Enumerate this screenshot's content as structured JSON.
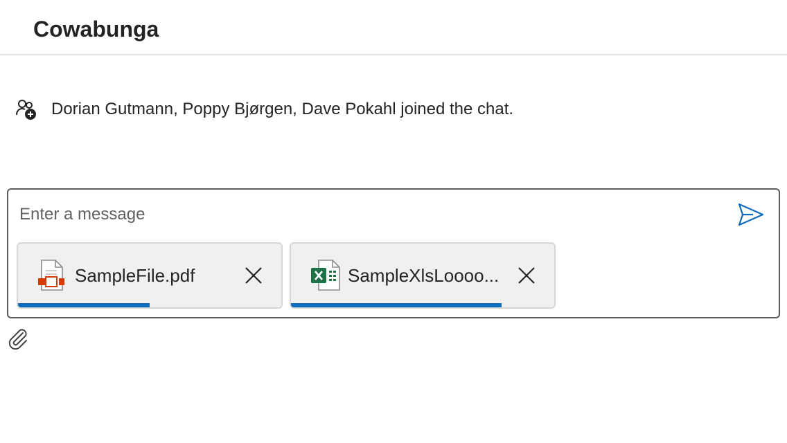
{
  "header": {
    "title": "Cowabunga"
  },
  "system_message": {
    "icon": "people-add-icon",
    "text": "Dorian Gutmann, Poppy Bjørgen, Dave Pokahl joined the chat."
  },
  "composer": {
    "placeholder": "Enter a message",
    "value": "",
    "send_icon": "send-icon",
    "attach_icon": "paperclip-icon",
    "attachments": [
      {
        "name": "SampleFile.pdf",
        "icon": "pdf-file-icon",
        "upload_progress": 0.5
      },
      {
        "name": "SampleXlsLoooo...",
        "icon": "excel-file-icon",
        "upload_progress": 0.8
      }
    ]
  },
  "colors": {
    "accent": "#0f6cbd",
    "excel": "#1e7145",
    "pdf": "#d83b01"
  }
}
